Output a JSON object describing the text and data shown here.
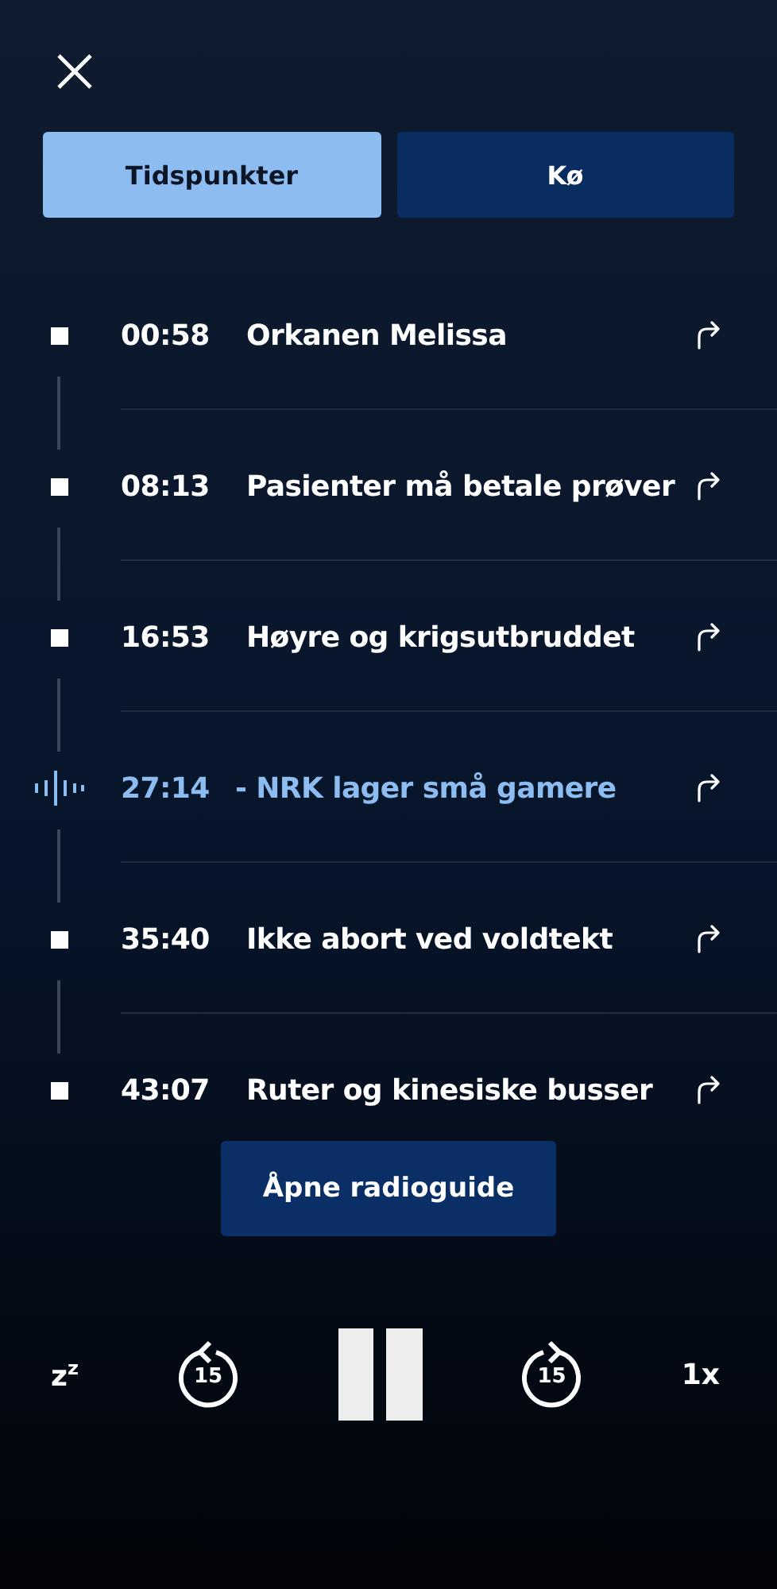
{
  "tabs": [
    {
      "label": "Tidspunkter",
      "selected": true
    },
    {
      "label": "Kø",
      "selected": false
    }
  ],
  "chapters": [
    {
      "time": "00:58",
      "title": "Orkanen Melissa",
      "playing": false
    },
    {
      "time": "08:13",
      "title": "Pasienter må betale prøver",
      "playing": false
    },
    {
      "time": "16:53",
      "title": "Høyre og krigsutbruddet",
      "playing": false
    },
    {
      "time": "27:14",
      "title": "- NRK lager små gamere",
      "playing": true
    },
    {
      "time": "35:40",
      "title": "Ikke abort ved voldtekt",
      "playing": false
    },
    {
      "time": "43:07",
      "title": "Ruter og kinesiske busser",
      "playing": false
    }
  ],
  "guide_button": "Åpne radioguide",
  "player": {
    "sleep": "z$^{z}$",
    "skip_back": "15",
    "skip_forward": "15",
    "speed": "1x",
    "paused": false
  }
}
